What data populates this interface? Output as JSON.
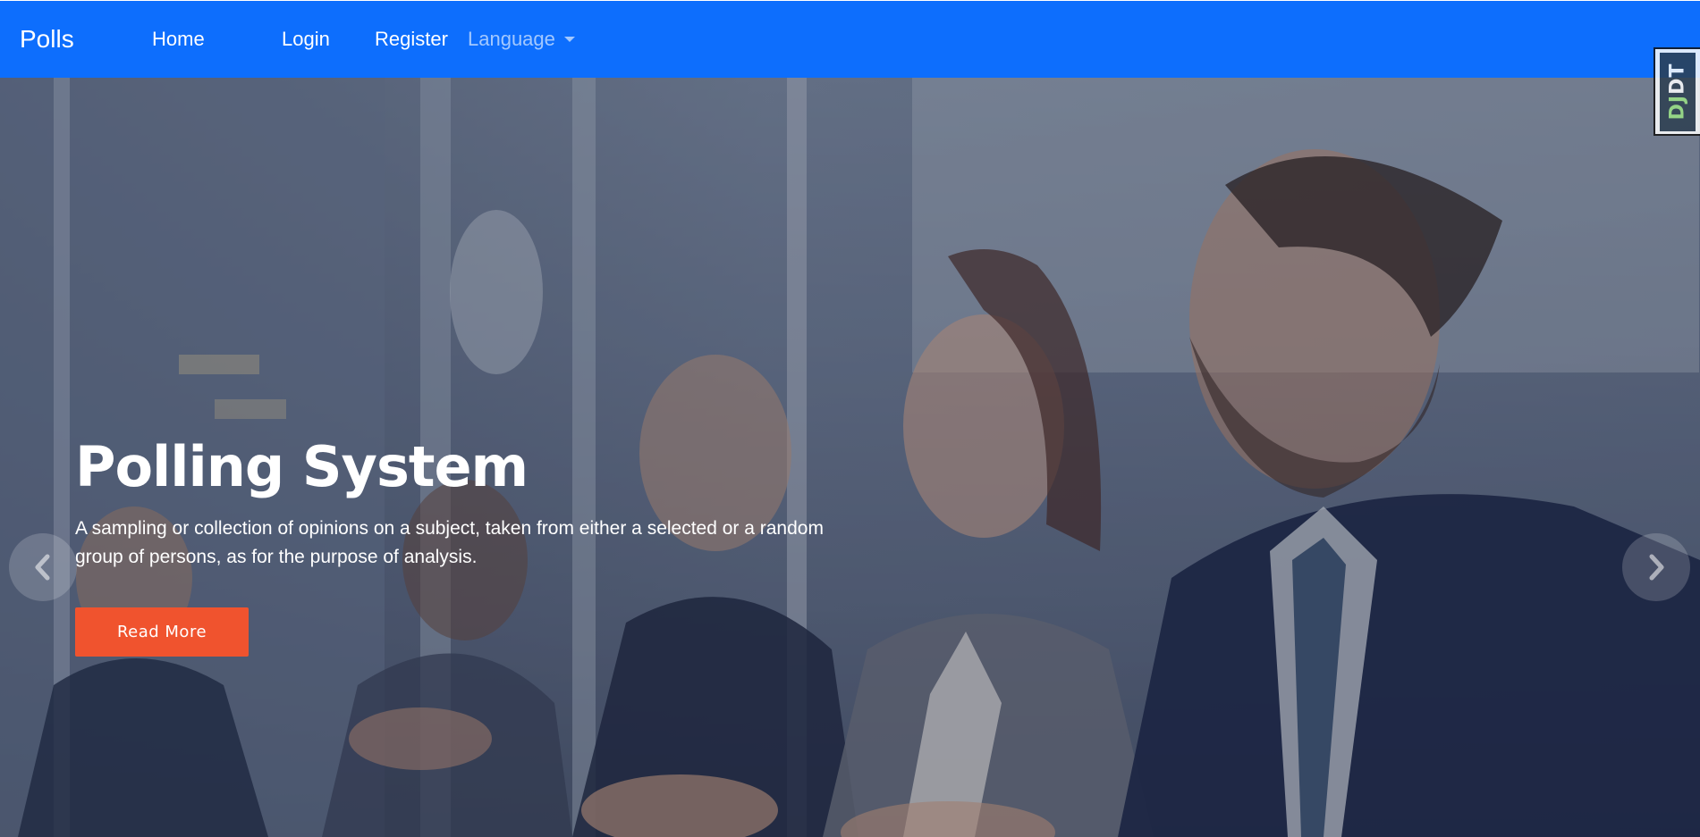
{
  "navbar": {
    "brand": "Polls",
    "links": {
      "home": "Home",
      "login": "Login",
      "register": "Register"
    },
    "language_dropdown": "Language",
    "background_color": "#0d6efd"
  },
  "debug_toolbar": {
    "handle_label_dj": "DJ",
    "handle_label_dt": "DT"
  },
  "hero": {
    "title": "Polling System",
    "description": "A sampling or collection of opinions on a subject, taken from either a selected or a random group of persons, as for the purpose of analysis.",
    "cta_label": "Read More",
    "cta_color": "#f0532e",
    "prev_icon": "chevron-left-icon",
    "next_icon": "chevron-right-icon"
  }
}
